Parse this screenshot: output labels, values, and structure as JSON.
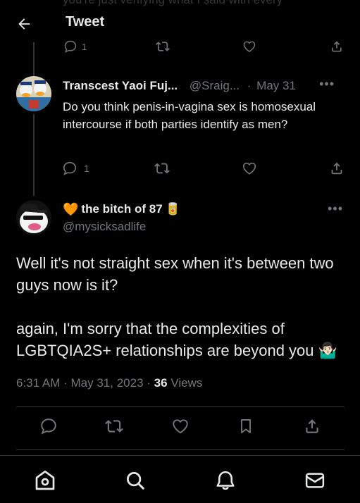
{
  "header": {
    "title": "Tweet",
    "scrolled_text": "you're just verifying what I said with every"
  },
  "previous_tweet": {
    "reply_count": "1"
  },
  "reply": {
    "display_name": "Transcest Yaoi Fuj...",
    "handle": "@Sraig...",
    "separator": "·",
    "date": "May 31",
    "text": "Do you think penis-in-vagina sex is homosexual intercourse if both parties identify as men?",
    "reply_count": "1"
  },
  "main_tweet": {
    "display_name": "the bitch of 87",
    "name_emoji_left": "🧡",
    "name_emoji_right": "🥫",
    "handle": "@mysicksadlife",
    "paragraph_1": "Well it's not straight sex when it's between two guys now is it?",
    "paragraph_2": "again, I'm sorry that the complexities of LGBTQIA2S+ relationships are beyond you 🤷🏻‍♂️",
    "time": "6:31 AM",
    "separator": "·",
    "date": "May 31, 2023",
    "views_count": "36",
    "views_label": "Views"
  },
  "icons": {
    "accent": "#71767b",
    "text": "#e7e9ea",
    "heart_emoji_color": "#f4900c"
  }
}
